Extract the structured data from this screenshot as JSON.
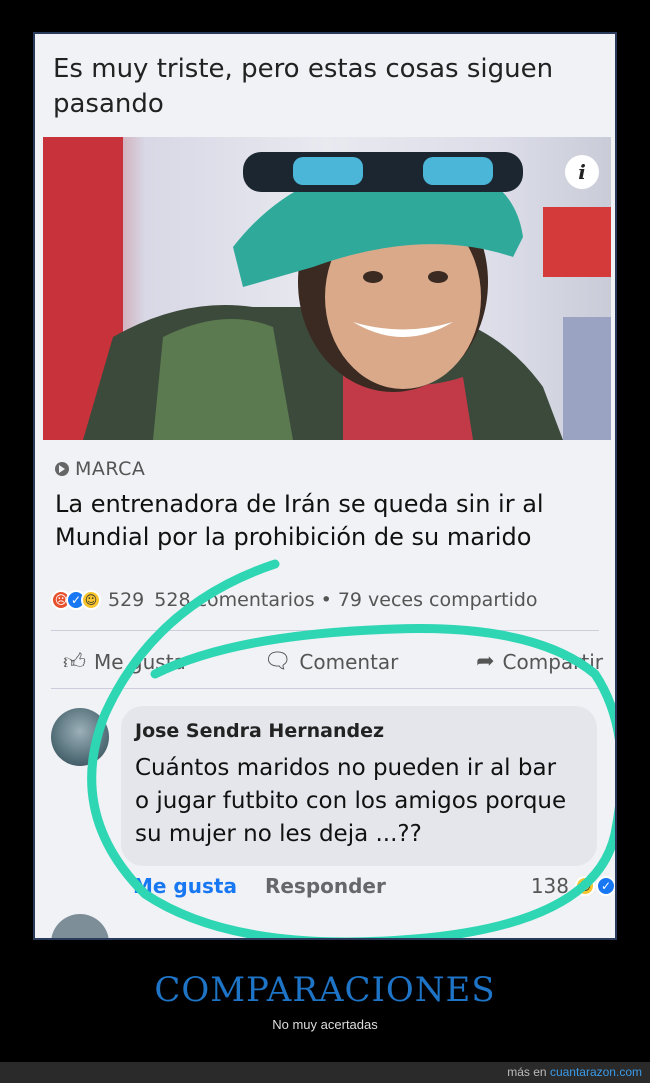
{
  "post": {
    "caption": "Es muy triste, pero estas cosas siguen pasando",
    "link": {
      "source": "MARCA",
      "headline": "La entrenadora de Irán se queda sin ir al Mundial por la prohibición de su marido"
    },
    "stats": {
      "reaction_count": "529",
      "comments": "528 comentarios",
      "separator": "•",
      "shares": "79 veces compartido"
    },
    "actions": {
      "like": "Me gusta",
      "comment": "Comentar",
      "share": "Compartir"
    },
    "comment": {
      "author": "Jose Sendra Hernandez",
      "text": "Cuántos maridos no pueden ir al bar o jugar futbito con los amigos porque su mujer no les deja ...??",
      "like_label": "Me gusta",
      "reply_label": "Responder",
      "reaction_count": "138"
    }
  },
  "site": {
    "title": "COMPARACIONES",
    "subtitle": "No muy acertadas",
    "footer_prefix": "más en",
    "footer_link": "cuantarazon.com"
  },
  "colors": {
    "brand_blue": "#1e74c6",
    "circle": "#2ed6b4",
    "fb_blue": "#1877f2"
  }
}
